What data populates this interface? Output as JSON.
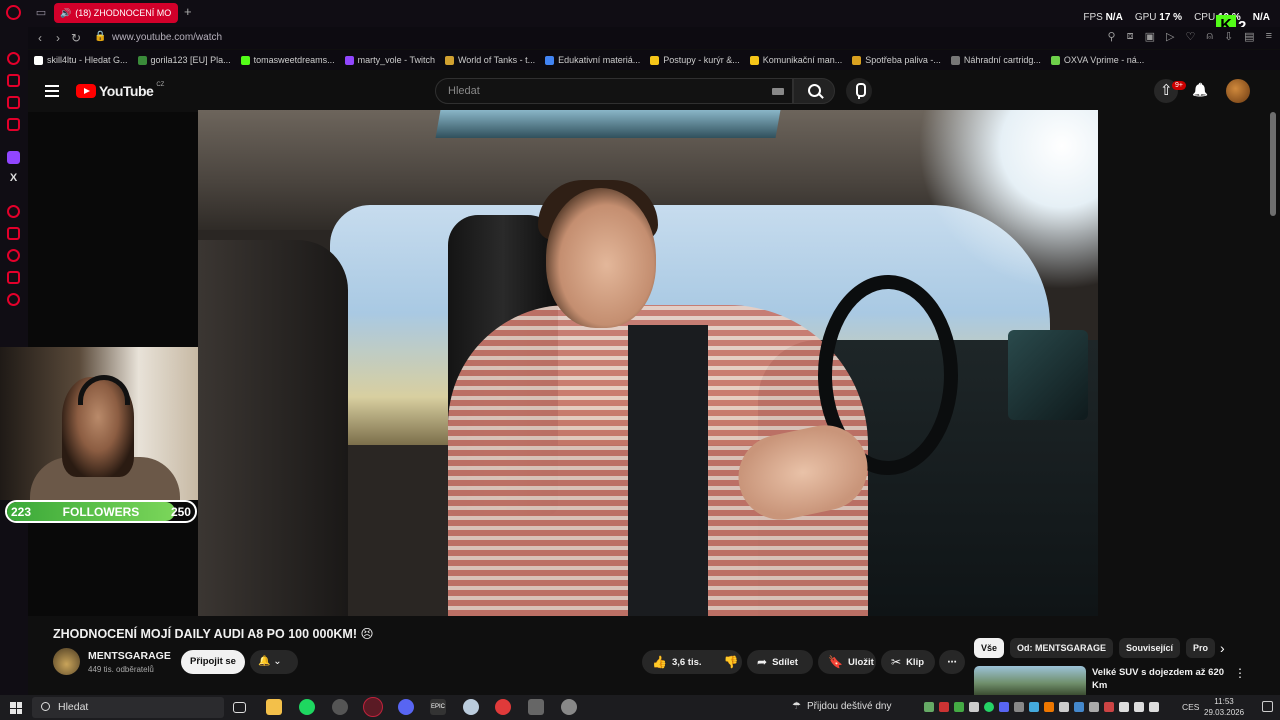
{
  "browser": {
    "active_tab": "(18) ZHODNOCENÍ MO",
    "url": "www.youtube.com/watch",
    "stats": {
      "fps_label": "FPS",
      "fps_value": "N/A",
      "gpu_label": "GPU",
      "gpu_value": "17 %",
      "cpu_label": "CPU",
      "cpu_value": "10 %",
      "extra_value": "N/A"
    },
    "kick_badge": "2",
    "bookmarks": [
      {
        "label": "skill4ltu - Hledat G...",
        "color": "#ffffff"
      },
      {
        "label": "gorila123 [EU] Pla...",
        "color": "#3a8a3a"
      },
      {
        "label": "tomasweetdreams...",
        "color": "#53fc18"
      },
      {
        "label": "marty_vole - Twitch",
        "color": "#9146ff"
      },
      {
        "label": "World of Tanks - t...",
        "color": "#d0a030"
      },
      {
        "label": "Edukativní materiá...",
        "color": "#4285f4"
      },
      {
        "label": "Postupy - kurýr &...",
        "color": "#f5c518"
      },
      {
        "label": "Komunikační man...",
        "color": "#f5c518"
      },
      {
        "label": "Spotřeba paliva -...",
        "color": "#d9a020"
      },
      {
        "label": "Náhradní cartridg...",
        "color": "#777777"
      },
      {
        "label": "OXVA Vprime - ná...",
        "color": "#6ed04a"
      }
    ]
  },
  "youtube": {
    "logo_text": "YouTube",
    "logo_country": "CZ",
    "search_placeholder": "Hledat",
    "notification_count": "9+",
    "video": {
      "title": "ZHODNOCENÍ MOJÍ DAILY AUDI A8 PO 100 000KM! 😣",
      "channel": "MENTSGARAGE",
      "subscribers": "449 tis. odběratelů",
      "subscribe_label": "Připojit se",
      "likes": "3,6 tis.",
      "share_label": "Sdílet",
      "save_label": "Uložit",
      "clip_label": "Klip",
      "more_label": "⋯"
    },
    "chips": [
      "Vše",
      "Od: MENTSGARAGE",
      "Související",
      "Pro"
    ],
    "recommendation": {
      "title": "Velké SUV s dojezdem až 620 Km"
    }
  },
  "overlay": {
    "followers_current": "223",
    "followers_label": "FOLLOWERS",
    "followers_goal": "250",
    "followers_fraction": 0.892
  },
  "taskbar": {
    "search_label": "Hledat",
    "weather": "Přijdou deštivé dny",
    "language": "CES",
    "time": "11:53",
    "date": "29.03.2026"
  }
}
